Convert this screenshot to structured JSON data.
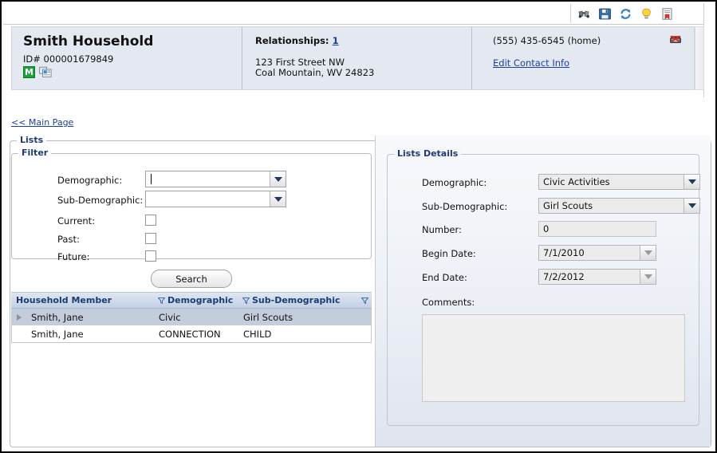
{
  "toolbar": {
    "icons": [
      {
        "name": "binoculars-icon",
        "label": "Find"
      },
      {
        "name": "save-icon",
        "label": "Save"
      },
      {
        "name": "refresh-icon",
        "label": "Refresh"
      },
      {
        "name": "lightbulb-icon",
        "label": "Tips"
      },
      {
        "name": "report-icon",
        "label": "Report"
      }
    ]
  },
  "header": {
    "household_name": "Smith Household",
    "id_label": "ID# 000001679849",
    "member_badge": "M",
    "relationships_label": "Relationships:",
    "relationships_count": "1",
    "address": "123 First Street NW\nCoal Mountain, WV 24823",
    "phone": "(555) 435-6545 (home)",
    "edit_contact_link": "Edit Contact Info"
  },
  "nav": {
    "main_page_link": "<< Main Page"
  },
  "lists": {
    "legend": "Lists",
    "filter": {
      "legend": "Filter",
      "demographic_label": "Demographic:",
      "demographic_value": "",
      "sub_demographic_label": "Sub-Demographic:",
      "sub_demographic_value": "",
      "current_label": "Current:",
      "past_label": "Past:",
      "future_label": "Future:",
      "current_checked": false,
      "past_checked": false,
      "future_checked": false
    },
    "search_button": "Search",
    "grid": {
      "columns": [
        "Household Member",
        "Demographic",
        "Sub-Demographic"
      ],
      "rows": [
        {
          "member": "Smith, Jane",
          "demographic": "Civic",
          "sub_demographic": "Girl Scouts",
          "selected": true
        },
        {
          "member": "Smith, Jane",
          "demographic": "CONNECTION",
          "sub_demographic": "CHILD",
          "selected": false
        }
      ]
    }
  },
  "details": {
    "legend": "Lists Details",
    "demographic_label": "Demographic:",
    "demographic_value": "Civic Activities",
    "sub_demographic_label": "Sub-Demographic:",
    "sub_demographic_value": "Girl Scouts",
    "number_label": "Number:",
    "number_value": "0",
    "begin_date_label": "Begin Date:",
    "begin_date_value": "7/1/2010",
    "end_date_label": "End Date:",
    "end_date_value": "7/2/2012",
    "comments_label": "Comments:",
    "comments_value": ""
  },
  "colors": {
    "header_panel_bg": "#e4e8f0",
    "link": "#1b3fa0",
    "legend": "#203a74",
    "grid_header_start": "#dfe6f1",
    "grid_header_end": "#c3d0e4",
    "row_selected": "#c3cddc",
    "badge_green": "#19a339"
  }
}
